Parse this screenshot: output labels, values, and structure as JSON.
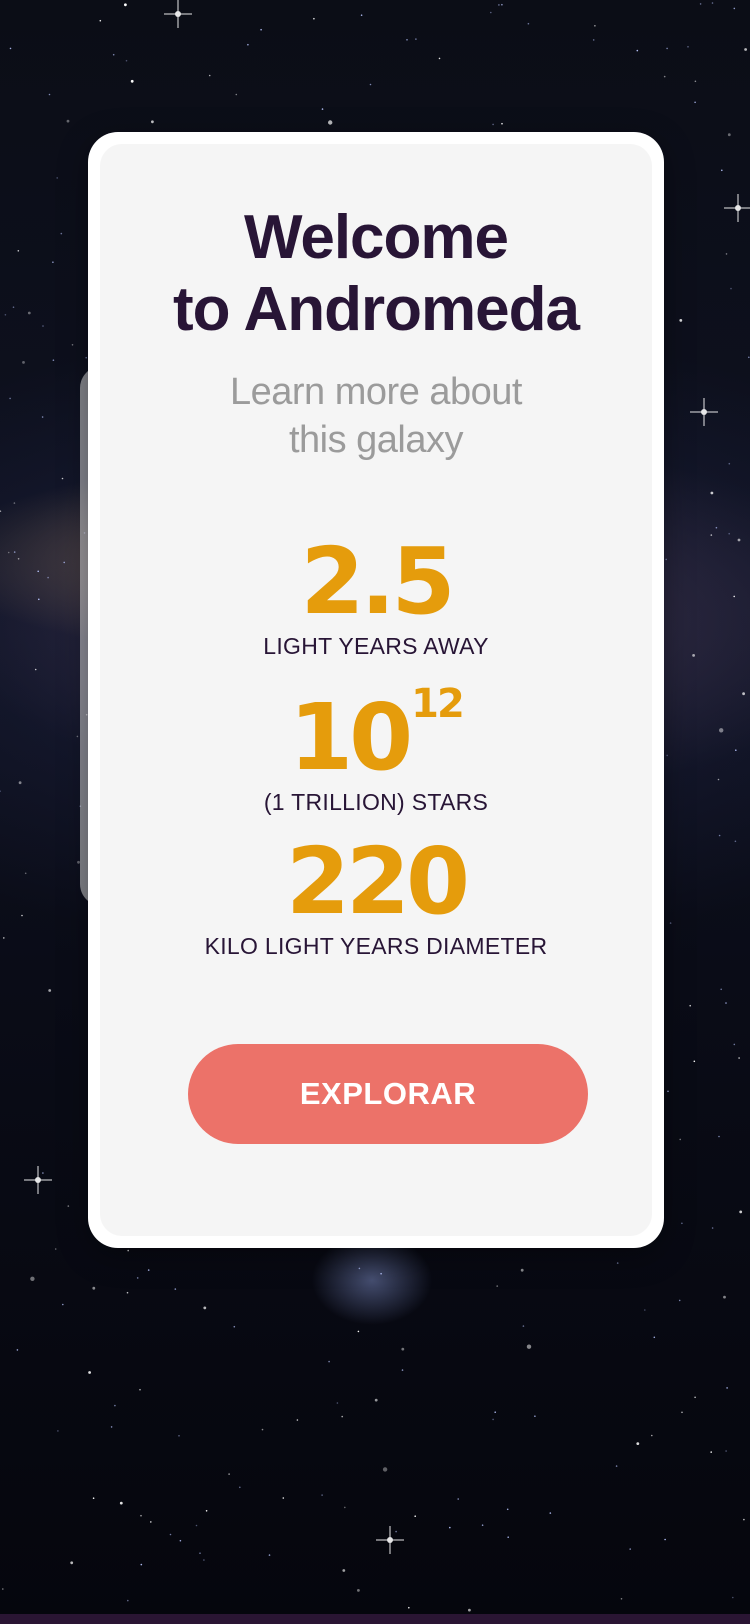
{
  "card": {
    "title_line1": "Welcome",
    "title_line2": "to Andromeda",
    "subtitle_line1": "Learn more about",
    "subtitle_line2": "this galaxy"
  },
  "stats": [
    {
      "value": "2.5",
      "label": "LIGHT YEARS AWAY"
    },
    {
      "value": "10",
      "exponent": "12",
      "label": "(1 TRILLION) STARS"
    },
    {
      "value": "220",
      "label": "KILO LIGHT YEARS DIAMETER"
    }
  ],
  "explore_button": {
    "label": "EXPLORAR"
  },
  "colors": {
    "title": "#281536",
    "subtitle": "#9b9b9b",
    "stat_value": "#e59c0c",
    "button": "#ec7269",
    "card": "#f5f5f5",
    "background": "#0b0d16"
  }
}
